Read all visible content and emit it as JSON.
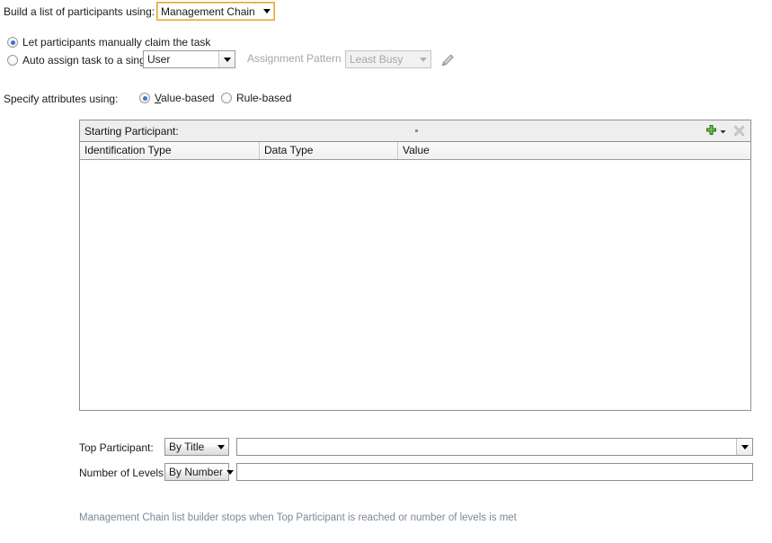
{
  "colors": {
    "focus_ring": "#e8a33d",
    "radio_dot": "#3b77c4",
    "add_icon_green": "#4aa32a",
    "disabled_text": "#a6a6a6",
    "hint_text": "#7b8896",
    "panel_header_bg": "#eeeeee"
  },
  "builder": {
    "label": "Build a list of participants using:",
    "selected": "Management Chain"
  },
  "assignment": {
    "manual_claim_label": "Let participants manually claim the task",
    "manual_claim_selected": true,
    "auto_assign_label": "Auto assign task to a single",
    "auto_assign_selected": false,
    "auto_assign_target": "User",
    "pattern_label": "Assignment Pattern :",
    "pattern_value": "Least Busy",
    "pattern_disabled": true,
    "edit_icon": "pencil-icon"
  },
  "attributes": {
    "label": "Specify attributes using:",
    "options": [
      {
        "label": "Value-based",
        "mnemonic": "V",
        "rest": "alue-based",
        "selected": true
      },
      {
        "label": "Rule-based",
        "mnemonic": "",
        "rest": "Rule-based",
        "selected": false
      }
    ]
  },
  "table": {
    "title": "Starting Participant:",
    "add_icon": "add-plus-icon",
    "add_dropdown_icon": "chevron-down-icon",
    "delete_icon": "delete-x-icon",
    "delete_disabled": true,
    "columns": [
      "Identification Type",
      "Data Type",
      "Value"
    ],
    "rows": []
  },
  "top_participant": {
    "label": "Top Participant:",
    "mode": "By Title",
    "value": "",
    "placeholder": ""
  },
  "number_of_levels": {
    "label": "Number of Levels:",
    "mode": "By Number",
    "value": "",
    "placeholder": ""
  },
  "footer": {
    "hint": "Management Chain list builder stops when Top Participant is reached or number of levels is met"
  }
}
